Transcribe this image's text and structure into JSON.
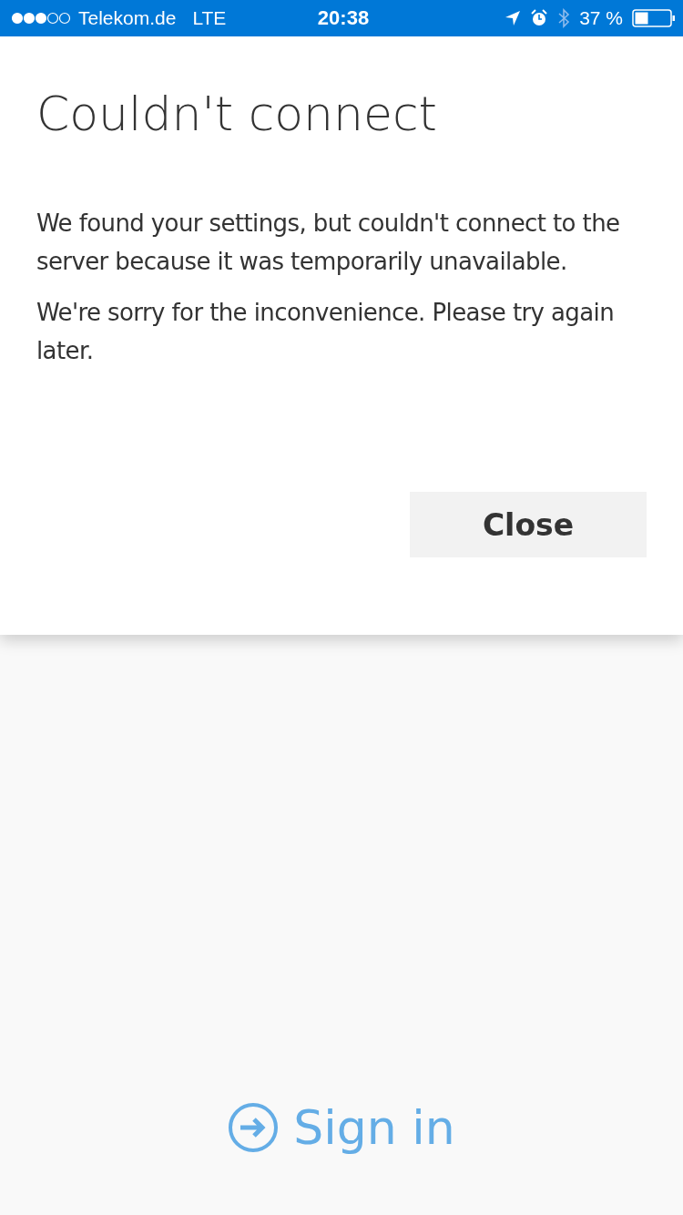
{
  "status_bar": {
    "carrier": "Telekom.de",
    "network": "LTE",
    "time": "20:38",
    "battery": "37 %"
  },
  "dialog": {
    "title": "Couldn't connect",
    "paragraphs": [
      "We found your settings, but couldn't connect to the server because it was temporarily unavailable.",
      "We're sorry for the inconvenience. Please try again later."
    ],
    "button": "Close"
  },
  "sign_in": {
    "label": "Sign in"
  }
}
